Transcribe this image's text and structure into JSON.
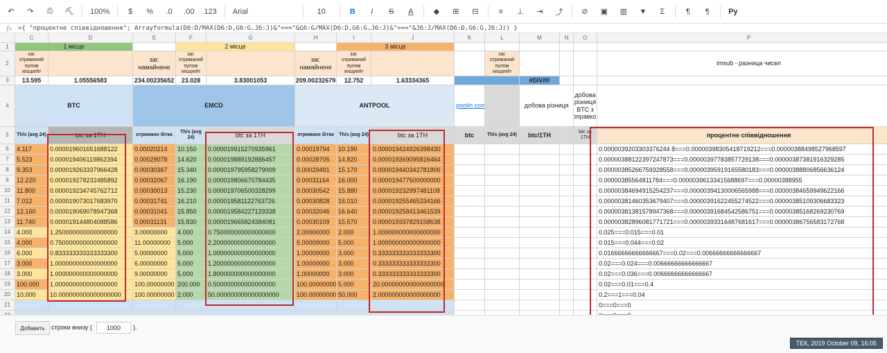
{
  "toolbar": {
    "undo_icon": "undo-icon",
    "zoom": "100%",
    "currency": "$",
    "percent": "%",
    "dec_less": ".0",
    "dec_more": ".00",
    "format_more": "123",
    "font": "Arial",
    "font_size": "10",
    "bold": "B",
    "italic": "I",
    "strike": "S",
    "text_color": "A",
    "functions": "Σ",
    "input_tools": "Pу"
  },
  "formula": {
    "fx": "fx",
    "text": "={ \"процентне співвідношення\"; Arrayformula(D6:D/MAX(D6:D,G6:G,J6:J)&\"===\"&G6:G/MAX(D6:D,G6:G,J6:J)&\"===\"&J6:J/MAX(D6:D,G6:G,J6:J)) }"
  },
  "columns": [
    {
      "id": "C",
      "label": "C"
    },
    {
      "id": "D",
      "label": "D"
    },
    {
      "id": "E",
      "label": "E"
    },
    {
      "id": "F",
      "label": "F"
    },
    {
      "id": "G",
      "label": "G"
    },
    {
      "id": "H",
      "label": "H"
    },
    {
      "id": "I",
      "label": "I"
    },
    {
      "id": "J",
      "label": "J"
    },
    {
      "id": "K",
      "label": "K"
    },
    {
      "id": "L",
      "label": "L"
    },
    {
      "id": "M",
      "label": "M"
    },
    {
      "id": "N",
      "label": "N"
    },
    {
      "id": "O",
      "label": "O"
    },
    {
      "id": "P",
      "label": "P"
    }
  ],
  "rows_numbers": [
    "1",
    "2",
    "3",
    "4",
    "5",
    "6",
    "7",
    "8",
    "9",
    "10",
    "11",
    "12",
    "13",
    "14",
    "15",
    "16",
    "17",
    "18",
    "19",
    "20",
    "21",
    "22"
  ],
  "header": {
    "place1": "1 місце",
    "place2": "2 місце",
    "place3": "3 місце",
    "total_pool": "заг. отриманий пулом хешрейт",
    "total_mined": "заг. намайнене",
    "r3_c": "13.595",
    "r3_d": "1.05556583",
    "r3_e": "234.00235652",
    "r3_f": "23.028",
    "r3_g": "3.83001053",
    "r3_h": "209.00232679",
    "r3_i": "12.752",
    "r3_j": "1.63334365",
    "r3_m": "#DIV/0!",
    "imsub": "imsub - разница чисел",
    "btc": "BTC",
    "emcd": "EMCD",
    "antpool": "ANTPOOL",
    "poolin": "poolin.com",
    "daily_diff": "добова різниця",
    "daily_diff_btc": "добова різниця BTC з поправкою",
    "ths": "Th/s (avg 24)",
    "btc_per_th": "btc за 1TH",
    "btc_received": "отримано бітка",
    "btc_col": "btc",
    "btc_1th": "btc/1TH",
    "btc_1th_short": "btc за 1TH",
    "percent_ratio": "процентне співвідношення"
  },
  "rows": [
    {
      "c": "4.117",
      "d": "0.000019601651688122",
      "e": "0.00020214",
      "f": "10.150",
      "g": "0.000019915270935961",
      "h": "0.00019794",
      "i": "10.190",
      "j": "0.000019424926398430",
      "p": "0.0000039203303376244 8===0.00000398305418719212===0.00000388498527968597"
    },
    {
      "c": "5.523",
      "d": "0.000019406119862394",
      "e": "0.00029078",
      "f": "14.620",
      "g": "0.000019889192886457",
      "h": "0.00028705",
      "i": "14.820",
      "j": "0.000019369095816464",
      "p": "0.00000388122397247873===0.00000397783857729138===0.00000387381916329285"
    },
    {
      "c": "9.353",
      "d": "0.000019263337966428",
      "e": "0.00030367",
      "f": "15.340",
      "g": "0.000019795958279009",
      "h": "0.00029491",
      "i": "15.170",
      "j": "0.000019440342781806",
      "p": "0.00000385266759328558===0.00000395919165580183===0.00000388806856636124"
    },
    {
      "c": "12.220",
      "d": "0.000019278232485892",
      "e": "0.00032067",
      "f": "16.190",
      "g": "0.000019806670784435",
      "h": "0.00031164",
      "i": "16.000",
      "j": "0.000019477500000000",
      "p": "0.00000385564811784===0.00000396133415688697===0.00000388955"
    },
    {
      "c": "11.800",
      "d": "0.000019234745762712",
      "e": "0.00030013",
      "f": "15.230",
      "g": "0.000019706500328299",
      "h": "0.00030542",
      "i": "15.880",
      "j": "0.000019232997481108",
      "p": "0.00000384694915254237===0.00000394130006565988===0.00000384659949622166"
    },
    {
      "c": "7.012",
      "d": "0.000019073017683970",
      "e": "0.00031741",
      "f": "16.210",
      "g": "0.000019581122763726",
      "h": "0.00030828",
      "i": "16.010",
      "j": "0.000019255465334166",
      "p": "0.00000381460353679407===0.00000391622455274522===0.00000385109306683323"
    },
    {
      "c": "12.160",
      "d": "0.000019069078947368",
      "e": "0.00031041",
      "f": "15.850",
      "g": "0.000019584227129338",
      "h": "0.00032046",
      "i": "16.640",
      "j": "0.000019258413461539",
      "p": "0.00000381381578947368===0.00000391684542586751===0.00000385168269230769"
    },
    {
      "c": "11.740",
      "d": "0.000019144804088586",
      "e": "0.00031131",
      "f": "15.830",
      "g": "0.000019665824384081",
      "h": "0.00030109",
      "i": "15.570",
      "j": "0.000019337829158638",
      "p": "0.00000382896081771721===0.00000393316487681617===0.00000386756583172768"
    },
    {
      "c": "4.000",
      "d": "1.250000000000000000",
      "e": "3.00000000",
      "f": "4.000",
      "g": "0.750000000000000000",
      "h": "2.00000000",
      "i": "2.000",
      "j": "1.000000000000000000",
      "p": "0.025===0.015===0.01"
    },
    {
      "c": "4.000",
      "d": "0.750000000000000000",
      "e": "11.00000000",
      "f": "5.000",
      "g": "2.200000000000000000",
      "h": "5.00000000",
      "i": "5.000",
      "j": "1.000000000000000000",
      "p": "0.015===0.044===0.02"
    },
    {
      "c": "6.000",
      "d": "0.833333333333333300",
      "e": "5.00000000",
      "f": "5.000",
      "g": "1.000000000000000000",
      "h": "1.00000000",
      "i": "3.000",
      "j": "0.333333333333333300",
      "p": "0.01666666666666667===0.02===0.00666666666666667"
    },
    {
      "c": "3.000",
      "d": "1.000000000000000000",
      "e": "6.00000000",
      "f": "5.000",
      "g": "1.200000000000000000",
      "h": "1.00000000",
      "i": "3.000",
      "j": "0.333333333333333300",
      "p": "0.02===0.024===0.00666666666666667"
    },
    {
      "c": "3.000",
      "d": "1.000000000000000000",
      "e": "9.00000000",
      "f": "5.000",
      "g": "1.800000000000000000",
      "h": "1.00000000",
      "i": "3.000",
      "j": "0.333333333333333300",
      "p": "0.02===0.036===0.00666666666666667"
    },
    {
      "c": "100.000",
      "d": "1.000000000000000000",
      "e": "100.00000000",
      "f": "200.000",
      "g": "0.500000000000000000",
      "h": "100.00000000",
      "i": "5.000",
      "j": "20.000000000000000000",
      "p": "0.02===0.01===0.4"
    },
    {
      "c": "10.000",
      "d": "10.000000000000000000",
      "e": "100.00000000",
      "f": "2.000",
      "g": "50.000000000000000000",
      "h": "100.00000000",
      "i": "50.000",
      "j": "2.000000000000000000",
      "p": "0.2===1===0.04"
    },
    {
      "c": "",
      "d": "",
      "e": "",
      "f": "",
      "g": "",
      "h": "",
      "i": "",
      "j": "",
      "p": "0===0===0"
    },
    {
      "c": "",
      "d": "",
      "e": "",
      "f": "",
      "g": "",
      "h": "",
      "i": "",
      "j": "",
      "p": "0===0===0"
    }
  ],
  "bottom": {
    "add_button": "Добавить",
    "rows_below": "строки внизу (",
    "count": "1000",
    "close_paren": ").",
    "clock": "ТЕК, 2019 October 09, 16:05"
  },
  "colors": {
    "green": "#93c47d",
    "light_green": "#b6d7a8",
    "orange": "#f6b26b",
    "yellow": "#ffe599",
    "blue": "#9fc5e8",
    "light_blue": "#cfe2f3",
    "peach": "#fce5cd",
    "red_box": "#c0272d"
  }
}
